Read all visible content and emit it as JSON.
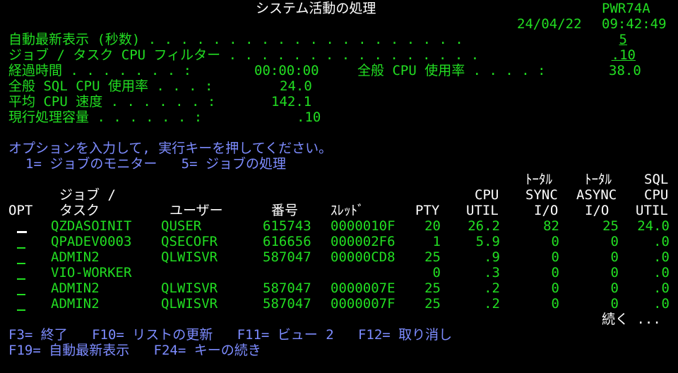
{
  "header": {
    "title": "システム活動の処理",
    "system_name": "PWR74A",
    "date": "24/04/22",
    "time": "09:42:49"
  },
  "params": {
    "auto_refresh_label": "自動最新表示 (秒数) . . . . . . . . . . . . . . . . . . . .",
    "auto_refresh_value": "5",
    "cpu_filter_label": "ジョブ / タスク CPU フィルター . . . . . . . . . . . . . . . .",
    "cpu_filter_value": ".10",
    "elapsed_label": "経過時間 . . . . . . . :",
    "elapsed_value": "00:00:00",
    "overall_cpu_label": "全般 CPU 使用率 . . . . :",
    "overall_cpu_value": "38.0",
    "sql_cpu_label": "全般 SQL CPU 使用率 . . . :",
    "sql_cpu_value": "24.0",
    "avg_cpu_label": "平均 CPU 速度 . . . . . . :",
    "avg_cpu_value": "142.1",
    "capacity_label": "現行処理容量 . . . . . . :",
    "capacity_value": ".10"
  },
  "instructions": "オプションを入力して, 実行キーを押してください。",
  "options_line": "1= ジョブのモニター   5= ジョブの処理",
  "columns": {
    "h_total1": "ﾄｰﾀﾙ",
    "h_total2": "ﾄｰﾀﾙ",
    "h_sql": "SQL",
    "h_job": "ジョブ /",
    "h_cpu": "CPU",
    "h_sync": "SYNC",
    "h_async": "ASYNC",
    "h_cpu2": "CPU",
    "h_opt": "OPT",
    "h_task": "タスク",
    "h_user": "ユーザー",
    "h_number": "番号",
    "h_thread": "ｽﾚｯﾄﾞ",
    "h_pty": "PTY",
    "h_util": "UTIL",
    "h_io1": "I/O",
    "h_io2": "I/O",
    "h_util2": "UTIL"
  },
  "rows": [
    {
      "job": "QZDASOINIT",
      "user": "QUSER",
      "number": "615743",
      "thread": "0000010F",
      "pty": "20",
      "cpu_util": "26.2",
      "sync_io": "82",
      "async_io": "25",
      "sql_cpu": "24.0"
    },
    {
      "job": "QPADEV0003",
      "user": "QSECOFR",
      "number": "616656",
      "thread": "000002F6",
      "pty": "1",
      "cpu_util": "5.9",
      "sync_io": "0",
      "async_io": "0",
      "sql_cpu": ".0"
    },
    {
      "job": "ADMIN2",
      "user": "QLWISVR",
      "number": "587047",
      "thread": "00000CD8",
      "pty": "25",
      "cpu_util": ".9",
      "sync_io": "0",
      "async_io": "0",
      "sql_cpu": ".0"
    },
    {
      "job": "VIO-WORKER",
      "user": "",
      "number": "",
      "thread": "",
      "pty": "0",
      "cpu_util": ".3",
      "sync_io": "0",
      "async_io": "0",
      "sql_cpu": ".0"
    },
    {
      "job": "ADMIN2",
      "user": "QLWISVR",
      "number": "587047",
      "thread": "0000007E",
      "pty": "25",
      "cpu_util": ".2",
      "sync_io": "0",
      "async_io": "0",
      "sql_cpu": ".0"
    },
    {
      "job": "ADMIN2",
      "user": "QLWISVR",
      "number": "587047",
      "thread": "0000007F",
      "pty": "25",
      "cpu_util": ".2",
      "sync_io": "0",
      "async_io": "0",
      "sql_cpu": ".0"
    }
  ],
  "more": "続く ...",
  "fkeys": {
    "line1": "F3= 終了   F10= リストの更新   F11= ビュー 2   F12= 取り消し",
    "line2": "F19= 自動最新表示   F24= キーの続き"
  }
}
